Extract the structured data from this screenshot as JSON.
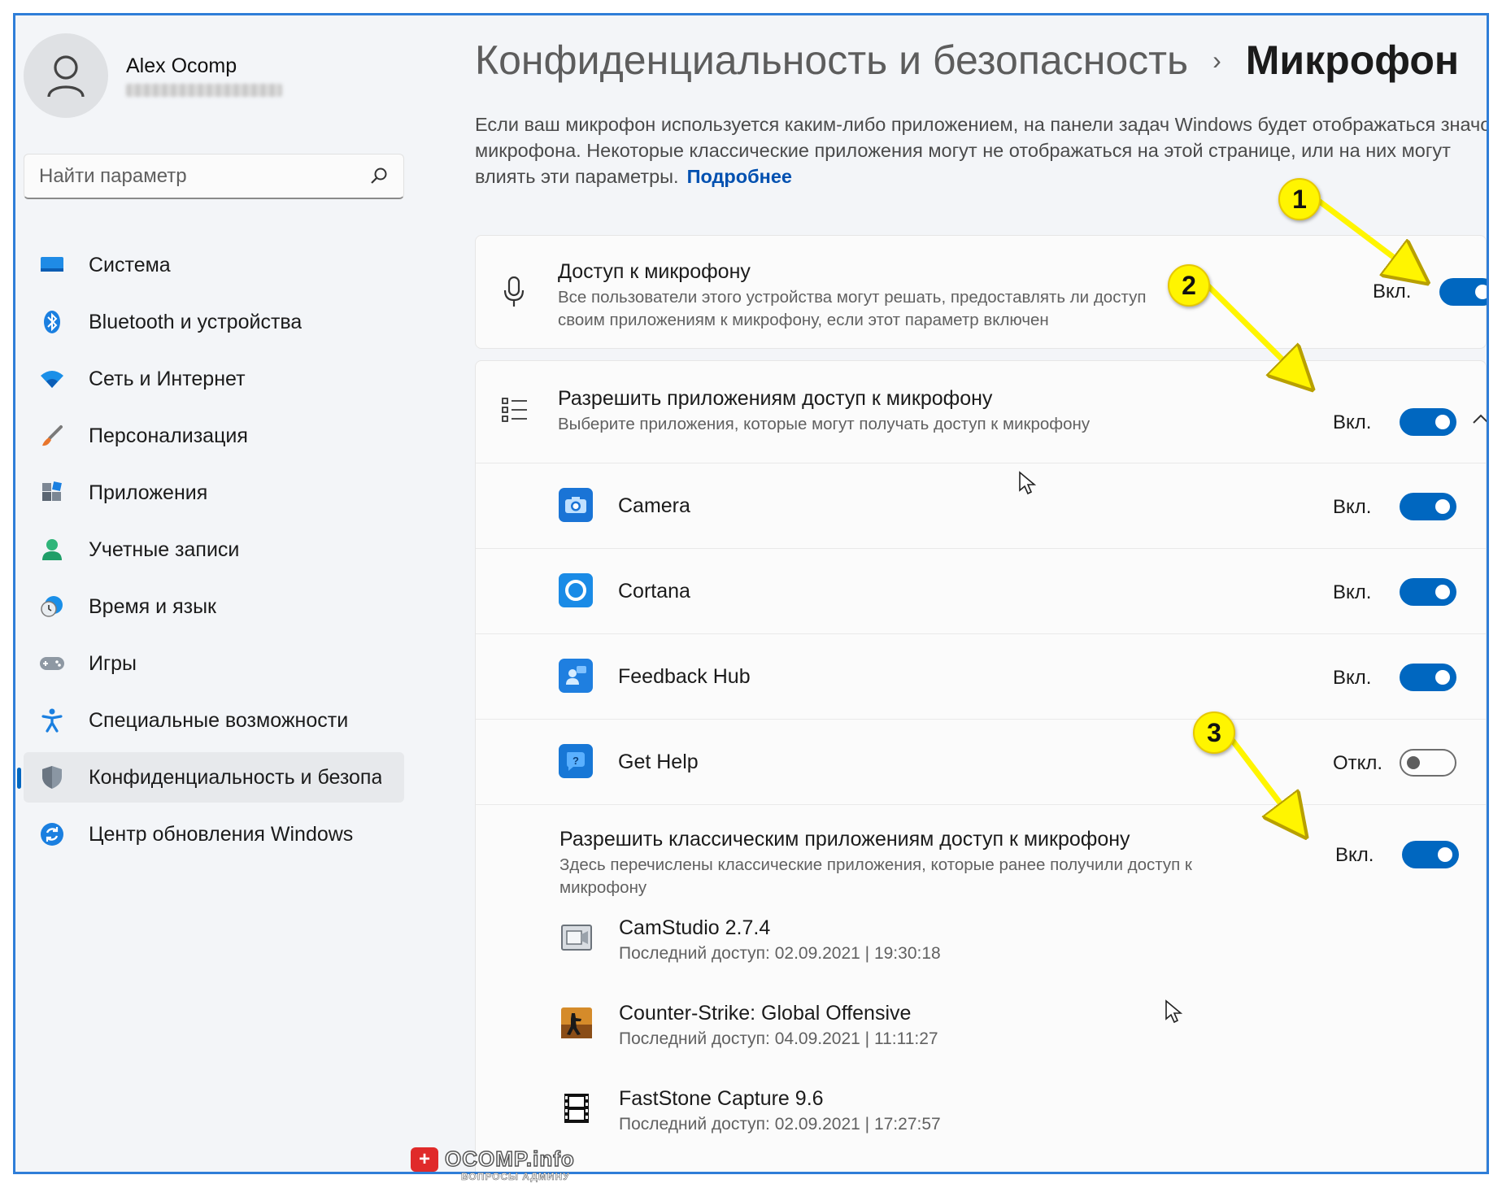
{
  "user": {
    "name": "Alex Ocomp"
  },
  "search": {
    "placeholder": "Найти параметр"
  },
  "sidebar": {
    "items": [
      {
        "label": "Система",
        "icon": "display-icon"
      },
      {
        "label": "Bluetooth и устройства",
        "icon": "bluetooth-icon"
      },
      {
        "label": "Сеть и Интернет",
        "icon": "wifi-icon"
      },
      {
        "label": "Персонализация",
        "icon": "brush-icon"
      },
      {
        "label": "Приложения",
        "icon": "apps-icon"
      },
      {
        "label": "Учетные записи",
        "icon": "person-icon"
      },
      {
        "label": "Время и язык",
        "icon": "clock-globe-icon"
      },
      {
        "label": "Игры",
        "icon": "gamepad-icon"
      },
      {
        "label": "Специальные возможности",
        "icon": "accessibility-icon"
      },
      {
        "label": "Конфиденциальность и безопас",
        "icon": "shield-icon",
        "active": true
      },
      {
        "label": "Центр обновления Windows",
        "icon": "update-icon"
      }
    ]
  },
  "header": {
    "breadcrumb_parent": "Конфиденциальность и безопасность",
    "breadcrumb_sep": "›",
    "title": "Микрофон"
  },
  "description": {
    "text": "Если ваш микрофон используется каким-либо приложением, на панели задач Windows будет отображаться значок микрофона. Некоторые классические приложения могут не отображаться на этой странице, или на них могут влиять эти параметры.",
    "link": "Подробнее"
  },
  "mic_access": {
    "title": "Доступ к микрофону",
    "subtitle": "Все пользователи этого устройства могут решать, предоставлять ли доступ своим приложениям к микрофону, если этот параметр включен",
    "status": "Вкл.",
    "on": true
  },
  "app_access": {
    "title": "Разрешить приложениям доступ к микрофону",
    "subtitle": "Выберите приложения, которые могут получать доступ к микрофону",
    "status": "Вкл.",
    "on": true,
    "apps": [
      {
        "name": "Camera",
        "status": "Вкл.",
        "on": true,
        "color": "#1a74d6"
      },
      {
        "name": "Cortana",
        "status": "Вкл.",
        "on": true,
        "color": "#1a8be6"
      },
      {
        "name": "Feedback Hub",
        "status": "Вкл.",
        "on": true,
        "color": "#1f7fe0"
      },
      {
        "name": "Get Help",
        "status": "Откл.",
        "on": false,
        "color": "#1777d6"
      }
    ]
  },
  "desktop_access": {
    "title": "Разрешить классическим приложениям доступ к микрофону",
    "subtitle": "Здесь перечислены классические приложения, которые ранее получили доступ к микрофону",
    "status": "Вкл.",
    "on": true,
    "apps": [
      {
        "name": "CamStudio 2.7.4",
        "last": "Последний доступ: 02.09.2021  |  19:30:18"
      },
      {
        "name": "Counter-Strike: Global Offensive",
        "last": "Последний доступ: 04.09.2021  |  11:11:27"
      },
      {
        "name": "FastStone Capture 9.6",
        "last": "Последний доступ: 02.09.2021  |  17:27:57"
      }
    ]
  },
  "annotations": {
    "badge1": "1",
    "badge2": "2",
    "badge3": "3"
  },
  "watermark": {
    "brand": "OCOMP.info",
    "tagline": "ВОПРОСЫ АДМИНУ",
    "logo_glyph": "+"
  },
  "colors": {
    "accent": "#0067c0",
    "frame": "#2f7ed8",
    "badge": "#fff500"
  }
}
